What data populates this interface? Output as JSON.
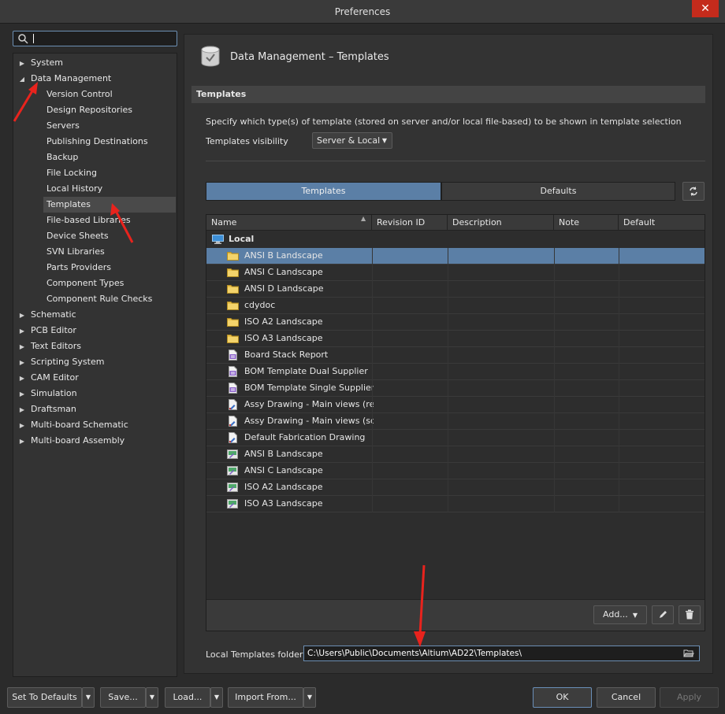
{
  "window": {
    "title": "Preferences",
    "close_label": "✕"
  },
  "search": {
    "value": "",
    "placeholder": ""
  },
  "tree": {
    "top_items": [
      {
        "label": "System",
        "expanded": false
      },
      {
        "label": "Data Management",
        "expanded": true
      },
      {
        "label": "Schematic",
        "expanded": false
      },
      {
        "label": "PCB Editor",
        "expanded": false
      },
      {
        "label": "Text Editors",
        "expanded": false
      },
      {
        "label": "Scripting System",
        "expanded": false
      },
      {
        "label": "CAM Editor",
        "expanded": false
      },
      {
        "label": "Simulation",
        "expanded": false
      },
      {
        "label": "Draftsman",
        "expanded": false
      },
      {
        "label": "Multi-board Schematic",
        "expanded": false
      },
      {
        "label": "Multi-board Assembly",
        "expanded": false
      }
    ],
    "children": [
      "Version Control",
      "Design Repositories",
      "Servers",
      "Publishing Destinations",
      "Backup",
      "File Locking",
      "Local History",
      "Templates",
      "File-based Libraries",
      "Device Sheets",
      "SVN Libraries",
      "Parts Providers",
      "Component Types",
      "Component Rule Checks"
    ],
    "selected": "Templates"
  },
  "page": {
    "title": "Data Management – Templates",
    "section": "Templates",
    "description": "Specify which type(s) of template (stored on server and/or local file-based) to be shown in template selection",
    "visibility_label": "Templates visibility",
    "visibility_value": "Server & Local",
    "tabs": [
      {
        "label": "Templates",
        "active": true
      },
      {
        "label": "Defaults",
        "active": false
      }
    ]
  },
  "grid": {
    "columns": [
      "Name",
      "Revision ID",
      "Description",
      "Note",
      "Default"
    ],
    "group": "Local",
    "rows": [
      {
        "name": "ANSI B Landscape",
        "icon": "folder-icon",
        "selected": true
      },
      {
        "name": "ANSI C Landscape",
        "icon": "folder-icon"
      },
      {
        "name": "ANSI D Landscape",
        "icon": "folder-icon"
      },
      {
        "name": "cdydoc",
        "icon": "folder-icon"
      },
      {
        "name": "ISO A2 Landscape",
        "icon": "folder-icon"
      },
      {
        "name": "ISO A3 Landscape",
        "icon": "folder-icon"
      },
      {
        "name": "Board Stack Report",
        "icon": "bom-document-icon"
      },
      {
        "name": "BOM Template Dual Supplier",
        "icon": "bom-document-icon"
      },
      {
        "name": "BOM Template Single Supplier",
        "icon": "bom-document-icon"
      },
      {
        "name": "Assy Drawing - Main views (rect",
        "icon": "drawing-document-icon"
      },
      {
        "name": "Assy Drawing - Main views (squa",
        "icon": "drawing-document-icon"
      },
      {
        "name": "Default Fabrication Drawing",
        "icon": "drawing-document-icon"
      },
      {
        "name": "ANSI B Landscape",
        "icon": "sheet-template-icon"
      },
      {
        "name": "ANSI C Landscape",
        "icon": "sheet-template-icon"
      },
      {
        "name": "ISO A2 Landscape",
        "icon": "sheet-template-icon"
      },
      {
        "name": "ISO A3 Landscape",
        "icon": "sheet-template-icon"
      }
    ],
    "add_label": "Add..."
  },
  "folder": {
    "label": "Local Templates folder",
    "value": "C:\\Users\\Public\\Documents\\Altium\\AD22\\Templates\\"
  },
  "bottom": {
    "set_defaults": "Set To Defaults",
    "save": "Save...",
    "load": "Load...",
    "import": "Import From...",
    "ok": "OK",
    "cancel": "Cancel",
    "apply": "Apply"
  },
  "colors": {
    "accent": "#5b7fa6",
    "annotation": "#e8231d"
  }
}
